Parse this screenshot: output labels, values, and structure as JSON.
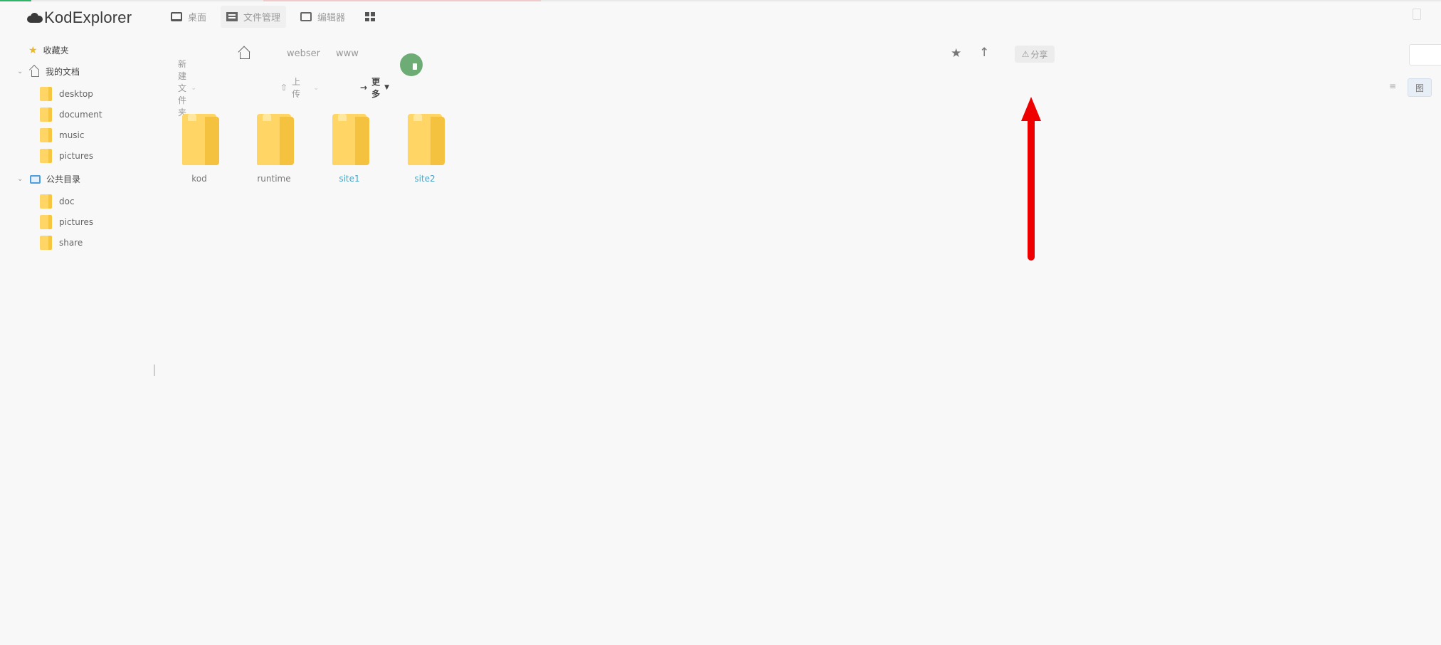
{
  "app": {
    "name": "KodExplorer"
  },
  "topnav": {
    "items": [
      {
        "label": "桌面",
        "icon": "desktop-icon"
      },
      {
        "label": "文件管理",
        "icon": "file-manager-icon"
      },
      {
        "label": "编辑器",
        "icon": "editor-icon"
      },
      {
        "label": "",
        "icon": "apps-grid-icon"
      }
    ]
  },
  "sidebar": {
    "favorites": {
      "label": "收藏夹",
      "icon": "star-icon"
    },
    "my_docs": {
      "label": "我的文档",
      "icon": "home-icon",
      "children": [
        "desktop",
        "document",
        "music",
        "pictures"
      ]
    },
    "public": {
      "label": "公共目录",
      "icon": "public-folder-icon",
      "children": [
        "doc",
        "pictures",
        "share"
      ]
    }
  },
  "pathbar": {
    "crumbs": [
      "webser",
      "www"
    ],
    "share_label": "分享"
  },
  "toolbar": {
    "new_folder": "新建文件夹",
    "upload": "上传",
    "more": "更多",
    "view_list_icon": "list-view-icon",
    "view_grid_label": "图"
  },
  "files": [
    {
      "name": "kod",
      "type": "folder"
    },
    {
      "name": "runtime",
      "type": "folder"
    },
    {
      "name": "site1",
      "type": "folder",
      "highlight": true
    },
    {
      "name": "site2",
      "type": "folder",
      "highlight": true
    }
  ],
  "colors": {
    "accent": "#2fb56a",
    "folder": "#ffd565",
    "link": "#4aa5c8",
    "annotation_arrow": "#ee0000"
  }
}
